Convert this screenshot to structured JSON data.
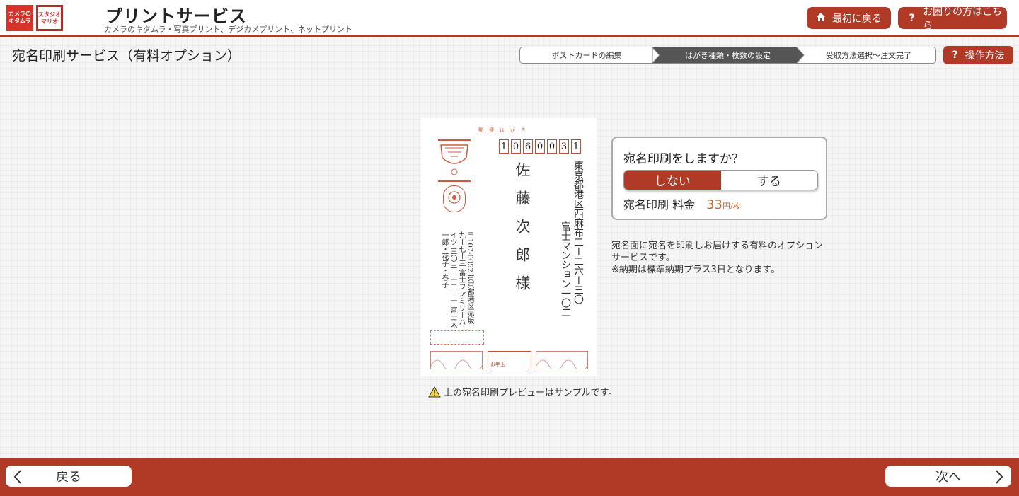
{
  "header": {
    "logo_left_text": "カメラのキタムラ",
    "logo_right_text": "スタジオマリオ",
    "title": "プリントサービス",
    "subtitle": "カメラのキタムラ・写真プリント、デジカメプリント、ネットプリント",
    "home_button": "最初に戻る",
    "help_button": "お困りの方はこちら"
  },
  "page": {
    "title": "宛名印刷サービス（有料オプション）",
    "operation_button": "操作方法"
  },
  "steps": [
    {
      "label": "ポストカードの編集",
      "active": false
    },
    {
      "label": "はがき種類・枚数の設定",
      "active": true
    },
    {
      "label": "受取方法選択～注文完了",
      "active": false
    }
  ],
  "postcard": {
    "top_label": "郵便はがき",
    "zip_digits": [
      "1",
      "0",
      "6",
      "0",
      "0",
      "3",
      "1"
    ],
    "recipient_name": "佐藤次郎様",
    "address_line1": "東京都港区西麻布二ー二六ー三〇",
    "address_line2": "富士マンション一〇二",
    "sender_text": "〒107-0052 東京都港区赤坂九ー七ー三 富士ファミリーハイツ 三〇三ー一二ー一 富士太一郎・花子・春子",
    "stamp_label": "お年玉"
  },
  "panel": {
    "question": "宛名印刷をしますか？",
    "option_no": "しない",
    "option_yes": "する",
    "selected": "しない",
    "price_label": "宛名印刷 料金",
    "price_value": "33",
    "price_unit": "円/枚"
  },
  "description": {
    "line1": "宛名面に宛名を印刷しお届けする有料のオプションサービスです。",
    "line2": "※納期は標準納期プラス3日となります。"
  },
  "preview_note": "上の宛名印刷プレビューはサンプルです。",
  "footer": {
    "back_button": "戻る",
    "next_button": "次へ"
  },
  "colors": {
    "accent": "#b03a26",
    "price": "#c06a3a"
  }
}
